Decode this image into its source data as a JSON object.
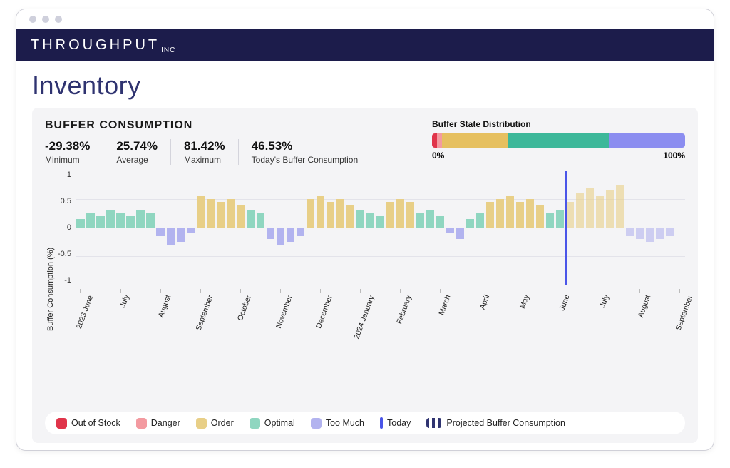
{
  "brand": {
    "name": "THROUGHPUT",
    "sub": "INC"
  },
  "page": {
    "title": "Inventory"
  },
  "panel": {
    "heading": "BUFFER CONSUMPTION",
    "stats": [
      {
        "value": "-29.38%",
        "label": "Minimum"
      },
      {
        "value": "25.74%",
        "label": "Average"
      },
      {
        "value": "81.42%",
        "label": "Maximum"
      },
      {
        "value": "46.53%",
        "label": "Today's Buffer Consumption"
      }
    ]
  },
  "distribution": {
    "title": "Buffer State Distribution",
    "min_label": "0%",
    "max_label": "100%",
    "segments": [
      {
        "state": "out_of_stock",
        "pct": 2,
        "color": "#e0344a"
      },
      {
        "state": "danger",
        "pct": 2,
        "color": "#f39aa0"
      },
      {
        "state": "order",
        "pct": 26,
        "color": "#e6c060"
      },
      {
        "state": "optimal",
        "pct": 40,
        "color": "#3db89a"
      },
      {
        "state": "too_much",
        "pct": 30,
        "color": "#8b8df0"
      }
    ]
  },
  "colors": {
    "out_of_stock": "#e0344a",
    "danger": "#f39aa0",
    "order": "#e8cf87",
    "optimal": "#8fd6c0",
    "too_much": "#b2b3ef",
    "today": "#4a55e8",
    "projected": "#2f3370"
  },
  "legend": [
    {
      "key": "out_of_stock",
      "label": "Out of Stock",
      "style": "box"
    },
    {
      "key": "danger",
      "label": "Danger",
      "style": "box"
    },
    {
      "key": "order",
      "label": "Order",
      "style": "box"
    },
    {
      "key": "optimal",
      "label": "Optimal",
      "style": "box"
    },
    {
      "key": "too_much",
      "label": "Too Much",
      "style": "box"
    },
    {
      "key": "today",
      "label": "Today",
      "style": "line"
    },
    {
      "key": "projected",
      "label": "Projected Buffer Consumption",
      "style": "dash"
    }
  ],
  "chart_data": {
    "type": "bar",
    "title": "Buffer Consumption",
    "ylabel": "Buffer Consumption (%)",
    "ylim": [
      -1,
      1
    ],
    "yticks": [
      1,
      0.5,
      0,
      -0.5,
      -1
    ],
    "today_index": 49,
    "x_ticks": [
      {
        "index": 0,
        "label": "2023 June"
      },
      {
        "index": 4,
        "label": "July"
      },
      {
        "index": 8,
        "label": "August"
      },
      {
        "index": 12,
        "label": "September"
      },
      {
        "index": 16,
        "label": "October"
      },
      {
        "index": 20,
        "label": "November"
      },
      {
        "index": 24,
        "label": "December"
      },
      {
        "index": 28,
        "label": "2024 January"
      },
      {
        "index": 32,
        "label": "February"
      },
      {
        "index": 36,
        "label": "March"
      },
      {
        "index": 40,
        "label": "April"
      },
      {
        "index": 44,
        "label": "May"
      },
      {
        "index": 48,
        "label": "June"
      },
      {
        "index": 52,
        "label": "July"
      },
      {
        "index": 56,
        "label": "August"
      },
      {
        "index": 60,
        "label": "September"
      }
    ],
    "series": [
      {
        "state": "optimal",
        "value": 0.15
      },
      {
        "state": "optimal",
        "value": 0.25
      },
      {
        "state": "optimal",
        "value": 0.2
      },
      {
        "state": "optimal",
        "value": 0.3
      },
      {
        "state": "optimal",
        "value": 0.25
      },
      {
        "state": "optimal",
        "value": 0.2
      },
      {
        "state": "optimal",
        "value": 0.3
      },
      {
        "state": "optimal",
        "value": 0.25
      },
      {
        "state": "too_much",
        "value": -0.15
      },
      {
        "state": "too_much",
        "value": -0.3
      },
      {
        "state": "too_much",
        "value": -0.25
      },
      {
        "state": "too_much",
        "value": -0.1
      },
      {
        "state": "order",
        "value": 0.55
      },
      {
        "state": "order",
        "value": 0.5
      },
      {
        "state": "order",
        "value": 0.45
      },
      {
        "state": "order",
        "value": 0.5
      },
      {
        "state": "order",
        "value": 0.4
      },
      {
        "state": "optimal",
        "value": 0.3
      },
      {
        "state": "optimal",
        "value": 0.25
      },
      {
        "state": "too_much",
        "value": -0.2
      },
      {
        "state": "too_much",
        "value": -0.3
      },
      {
        "state": "too_much",
        "value": -0.25
      },
      {
        "state": "too_much",
        "value": -0.15
      },
      {
        "state": "order",
        "value": 0.5
      },
      {
        "state": "order",
        "value": 0.55
      },
      {
        "state": "order",
        "value": 0.45
      },
      {
        "state": "order",
        "value": 0.5
      },
      {
        "state": "order",
        "value": 0.4
      },
      {
        "state": "optimal",
        "value": 0.3
      },
      {
        "state": "optimal",
        "value": 0.25
      },
      {
        "state": "optimal",
        "value": 0.2
      },
      {
        "state": "order",
        "value": 0.45
      },
      {
        "state": "order",
        "value": 0.5
      },
      {
        "state": "order",
        "value": 0.45
      },
      {
        "state": "optimal",
        "value": 0.25
      },
      {
        "state": "optimal",
        "value": 0.3
      },
      {
        "state": "optimal",
        "value": 0.2
      },
      {
        "state": "too_much",
        "value": -0.1
      },
      {
        "state": "too_much",
        "value": -0.2
      },
      {
        "state": "optimal",
        "value": 0.15
      },
      {
        "state": "optimal",
        "value": 0.25
      },
      {
        "state": "order",
        "value": 0.45
      },
      {
        "state": "order",
        "value": 0.5
      },
      {
        "state": "order",
        "value": 0.55
      },
      {
        "state": "order",
        "value": 0.45
      },
      {
        "state": "order",
        "value": 0.5
      },
      {
        "state": "order",
        "value": 0.4
      },
      {
        "state": "optimal",
        "value": 0.25
      },
      {
        "state": "optimal",
        "value": 0.3
      },
      {
        "state": "order",
        "value": 0.45,
        "projected": true
      },
      {
        "state": "order",
        "value": 0.6,
        "projected": true
      },
      {
        "state": "order",
        "value": 0.7,
        "projected": true
      },
      {
        "state": "order",
        "value": 0.55,
        "projected": true
      },
      {
        "state": "order",
        "value": 0.65,
        "projected": true
      },
      {
        "state": "order",
        "value": 0.75,
        "projected": true
      },
      {
        "state": "too_much",
        "value": -0.15,
        "projected": true
      },
      {
        "state": "too_much",
        "value": -0.2,
        "projected": true
      },
      {
        "state": "too_much",
        "value": -0.25,
        "projected": true
      },
      {
        "state": "too_much",
        "value": -0.2,
        "projected": true
      },
      {
        "state": "too_much",
        "value": -0.15,
        "projected": true
      },
      {
        "state": "none",
        "value": 0
      }
    ]
  }
}
